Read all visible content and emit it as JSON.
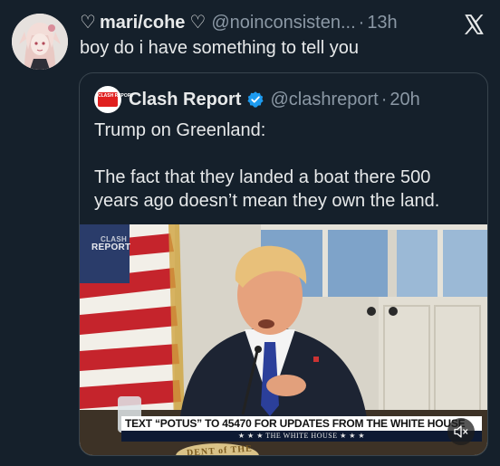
{
  "tweet": {
    "display_name": "mari/cohe",
    "handle": "@noinconsisten...",
    "separator": "·",
    "time": "13h",
    "text": "boy do i have something to tell you",
    "heart_glyph": "♡"
  },
  "quote": {
    "display_name": "Clash Report",
    "handle": "@clashreport",
    "separator": "·",
    "time": "20h",
    "text_line1": "Trump on Greenland:",
    "text_line2": "The fact that they landed a boat there 500 years ago doesn’t mean they own the land.",
    "avatar_text": "CLASH REPORT"
  },
  "media": {
    "watermark_line1": "CLASH",
    "watermark_line2": "REPORT",
    "banner_text": "TEXT “POTUS” TO 45470 FOR UPDATES FROM THE WHITE HOUSE",
    "banner_subtext": "★ ★ ★   THE WHITE HOUSE   ★ ★ ★",
    "seal_text": "DENT of THE",
    "mute_glyph": "🔇"
  },
  "colors": {
    "background": "#15202b",
    "text_primary": "#e7e9ea",
    "text_secondary": "#8b98a5",
    "border": "#38444d",
    "verified_blue": "#1d9bf0",
    "clash_red": "#e0201f"
  }
}
